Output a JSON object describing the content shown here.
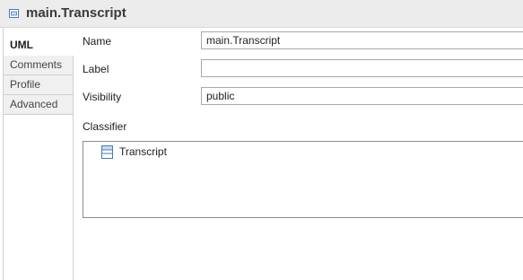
{
  "header": {
    "title": "main.Transcript",
    "icon": "uml-element-icon"
  },
  "tabs": [
    {
      "label": "UML",
      "active": true
    },
    {
      "label": "Comments",
      "active": false
    },
    {
      "label": "Profile",
      "active": false
    },
    {
      "label": "Advanced",
      "active": false
    }
  ],
  "form": {
    "name_label": "Name",
    "name_value": "main.Transcript",
    "label_label": "Label",
    "label_value": "",
    "visibility_label": "Visibility",
    "visibility_value": "public",
    "classifier_label": "Classifier",
    "classifier_items": [
      {
        "label": "Transcript",
        "icon": "class-icon"
      }
    ]
  },
  "colors": {
    "header_bg": "#ececec",
    "icon_blue": "#4a7bb5"
  }
}
